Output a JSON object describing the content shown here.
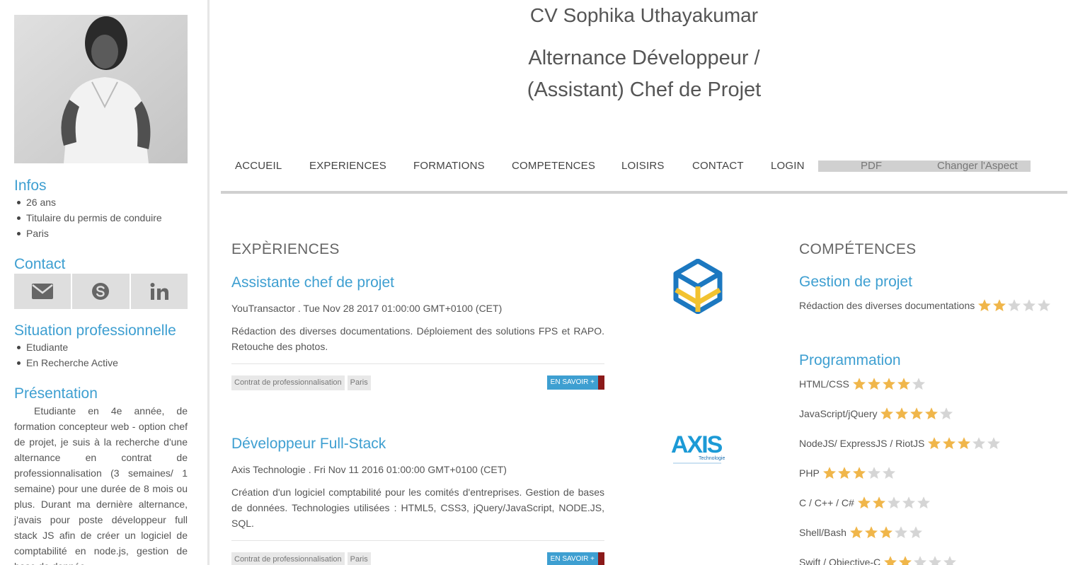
{
  "sidebar": {
    "photo_alt": "Photo de Sophika Uthayakumar",
    "infos_title": "Infos",
    "infos": [
      "26 ans",
      "Titulaire du permis de conduire",
      "Paris"
    ],
    "contact_title": "Contact",
    "contact_icons": [
      "envelope-icon",
      "skype-icon",
      "linkedin-icon"
    ],
    "situation_title": "Situation professionnelle",
    "situation": [
      "Etudiante",
      "En Recherche Active"
    ],
    "presentation_title": "Présentation",
    "presentation_text": "Etudiante en 4e année, de formation concepteur web - option chef de projet, je suis à la recherche d'une alternance en contrat de professionnalisation (3 semaines/ 1 semaine) pour une durée de 8 mois ou plus. Durant ma dernière alternance, j'avais pour poste développeur full stack JS afin de créer un logiciel de comptabilité en node.js, gestion de base de donnée"
  },
  "header": {
    "cv_title": "CV Sophika Uthayakumar",
    "job_title_line1": "Alternance Développeur /",
    "job_title_line2": "(Assistant) Chef de Projet"
  },
  "nav": {
    "items": [
      "ACCUEIL",
      "EXPERIENCES",
      "FORMATIONS",
      "COMPETENCES",
      "LOISIRS",
      "CONTACT",
      "LOGIN"
    ],
    "pdf": "PDF",
    "change_aspect": "Changer l'Aspect"
  },
  "experiences": {
    "title": "EXPÈRIENCES",
    "more_label": "EN SAVOIR +",
    "items": [
      {
        "title": "Assistante chef de projet",
        "meta": "YouTransactor . Tue Nov 28 2017 01:00:00 GMT+0100 (CET)",
        "description": "Rédaction des diverses documentations. Déploiement des solutions FPS et RAPO. Retouche des photos.",
        "tags": [
          "Contrat de professionnalisation",
          "Paris"
        ],
        "logo": "youtransactor-logo"
      },
      {
        "title": "Développeur Full-Stack",
        "meta": "Axis Technologie . Fri Nov 11 2016 01:00:00 GMT+0100 (CET)",
        "description": "Création d'un logiciel comptabilité pour les comités d'entreprises. Gestion de bases de données. Technologies utilisées : HTML5, CSS3, jQuery/JavaScript, NODE.JS, SQL.",
        "tags": [
          "Contrat de professionnalisation",
          "Paris"
        ],
        "logo": "axis-logo"
      }
    ],
    "axis_logo_text": "AXIS",
    "axis_logo_sub": "Technologie"
  },
  "competences": {
    "title": "COMPÉTENCES",
    "categories": [
      {
        "name": "Gestion de projet",
        "skills": [
          {
            "name": "Rédaction des diverses documentations",
            "rating": 2
          }
        ]
      },
      {
        "name": "Programmation",
        "skills": [
          {
            "name": "HTML/CSS",
            "rating": 4
          },
          {
            "name": "JavaScript/jQuery",
            "rating": 4
          },
          {
            "name": "NodeJS/ ExpressJS / RiotJS",
            "rating": 3
          },
          {
            "name": "PHP",
            "rating": 3
          },
          {
            "name": "C / C++ / C#",
            "rating": 2
          },
          {
            "name": "Shell/Bash",
            "rating": 3
          },
          {
            "name": "Swift / Objective-C",
            "rating": 2
          }
        ]
      }
    ],
    "max_rating": 5
  },
  "colors": {
    "accent": "#3e9fd1",
    "star_on": "#f0b64a",
    "star_off": "#d5d5d5",
    "more_end": "#8b1a1a"
  }
}
